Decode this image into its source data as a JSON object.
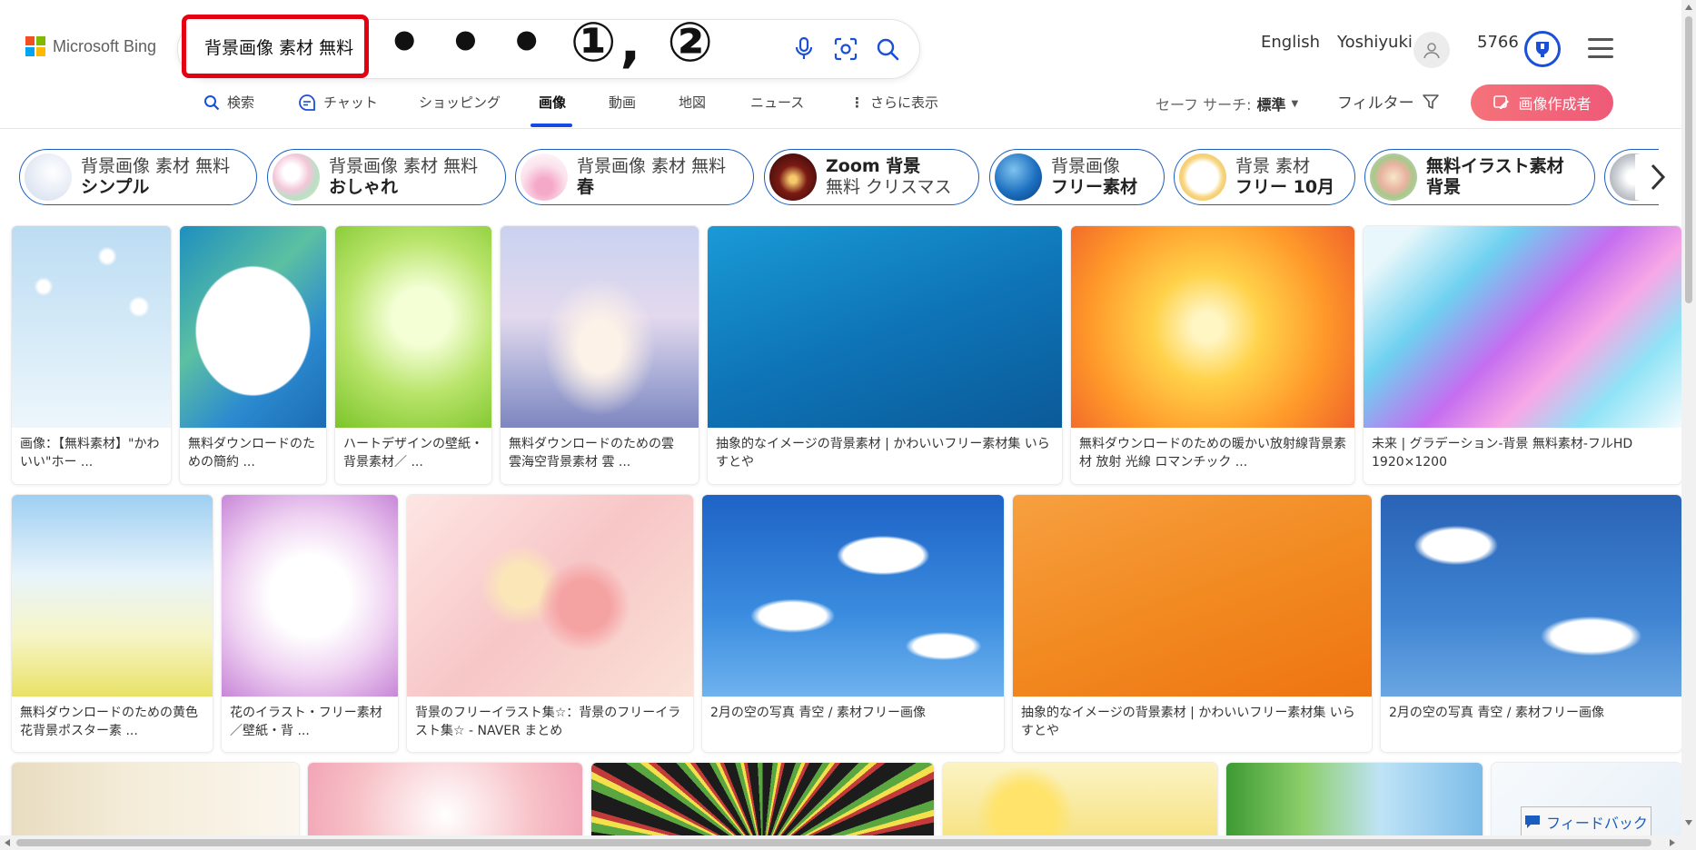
{
  "header": {
    "logo_text": "Microsoft Bing",
    "query": "背景画像 素材 無料",
    "annotation": "• • •  ①, ②",
    "language_link": "English",
    "user_name": "Yoshiyuki",
    "reward_points": "5766",
    "icons": [
      "microphone-icon",
      "visual-search-icon",
      "search-icon",
      "user-icon",
      "rewards-icon",
      "menu-icon"
    ]
  },
  "nav": {
    "items": [
      {
        "label": "検索",
        "icon": "search-icon"
      },
      {
        "label": "チャット",
        "icon": "chat-icon"
      },
      {
        "label": "ショッピング"
      },
      {
        "label": "画像"
      },
      {
        "label": "動画"
      },
      {
        "label": "地図"
      },
      {
        "label": "ニュース"
      },
      {
        "label": "さらに表示",
        "icon": "more-icon"
      }
    ],
    "active": "画像",
    "safesearch_label": "セーフ サーチ:",
    "safesearch_value": "標準",
    "filter_label": "フィルター",
    "creator_button": "画像作成者"
  },
  "related": [
    {
      "line1": "背景画像 素材 無料",
      "line2": "シンプル"
    },
    {
      "line1": "背景画像 素材 無料",
      "line2": "おしゃれ"
    },
    {
      "line1": "背景画像 素材 無料",
      "line2": "春"
    },
    {
      "line1": "Zoom 背景",
      "line2": "無料 クリスマス"
    },
    {
      "line1": "背景画像",
      "line2": "フリー素材"
    },
    {
      "line1": "背景 素材",
      "line2": "フリー 10月"
    },
    {
      "line1": "無料イラスト素材",
      "line2": "背景"
    }
  ],
  "results": {
    "row1": [
      {
        "caption": "画像：【無料素材】\"かわいい\"ホー ..."
      },
      {
        "caption": "無料ダウンロードのための簡約 ..."
      },
      {
        "caption": "ハートデザインの壁紙・背景素材／ ..."
      },
      {
        "caption": "無料ダウンロードのための雲 雲海空背景素材 雲 ..."
      },
      {
        "caption": "抽象的なイメージの背景素材 | かわいいフリー素材集 いらすとや"
      },
      {
        "caption": "無料ダウンロードのための暖かい放射線背景素材 放射 光線 ロマンチック ..."
      },
      {
        "caption": "未来 | グラデーション-背景 無料素材-フルHD 1920×1200"
      }
    ],
    "row2": [
      {
        "caption": "無料ダウンロードのための黄色花背景ポスター素 ..."
      },
      {
        "caption": "花のイラスト・フリー素材／壁紙・背 ..."
      },
      {
        "caption": "背景のフリーイラスト集☆：背景のフリーイラスト集☆ - NAVER まとめ"
      },
      {
        "caption": "2月の空の写真 青空 / 素材フリー画像"
      },
      {
        "caption": "抽象的なイメージの背景素材 | かわいいフリー素材集 いらすとや"
      },
      {
        "caption": "2月の空の写真 青空 / 素材フリー画像"
      }
    ]
  },
  "feedback_label": "フィードバック",
  "colors": {
    "accent": "#174ae4",
    "highlight_border": "#e50012",
    "creator_button": "#f0637a",
    "chip_border": "#1a5dbf"
  }
}
